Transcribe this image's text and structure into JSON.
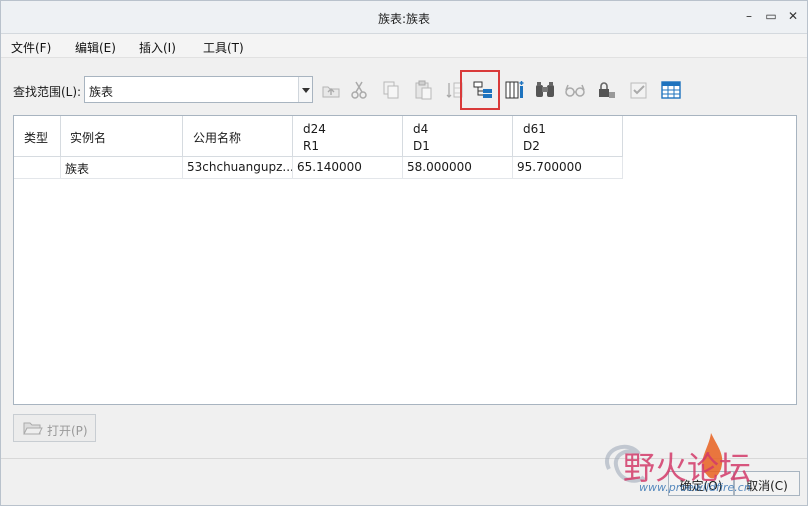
{
  "window": {
    "title": "族表:族表"
  },
  "menu": [
    "文件(F)",
    "编辑(E)",
    "插入(I)",
    "工具(T)"
  ],
  "toolbar": {
    "lookin_label": "查找范围(L):",
    "lookin_value": "族表",
    "icons": [
      "up-folder-icon",
      "cut-icon",
      "copy-icon",
      "paste-icon",
      "insert-rows-icon",
      "add-item-icon",
      "add-column-icon",
      "find-icon",
      "preview-icon",
      "lock-icon",
      "verify-icon",
      "table-icon"
    ]
  },
  "table": {
    "columns": [
      {
        "label": "类型"
      },
      {
        "label": "实例名"
      },
      {
        "label": "公用名称"
      },
      {
        "label": "d24",
        "sub": "R1"
      },
      {
        "label": "d4",
        "sub": "D1"
      },
      {
        "label": "d61",
        "sub": "D2"
      }
    ],
    "rows": [
      [
        "",
        "族表",
        "53chchuangupz...",
        "65.140000",
        "58.000000",
        "95.700000"
      ]
    ]
  },
  "open_button": {
    "label": "打开(P)"
  },
  "ok_button": {
    "label": "确定(O)"
  },
  "cancel_button": {
    "label": "取消(C)"
  },
  "watermark": {
    "text": "野火论坛",
    "url": "www.proewildfire.cn"
  },
  "colors": {
    "highlight": "#d93a3a",
    "accent_blue": "#1e73be"
  }
}
